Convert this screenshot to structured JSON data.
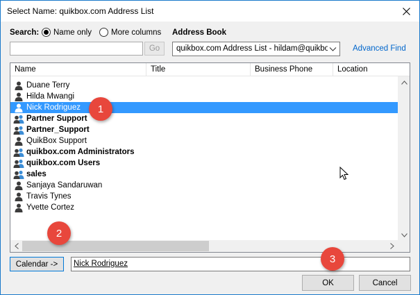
{
  "window": {
    "title": "Select Name: quikbox.com Address List"
  },
  "search": {
    "label": "Search:",
    "options": [
      {
        "label": "Name only",
        "selected": true
      },
      {
        "label": "More columns",
        "selected": false
      }
    ],
    "input_value": "",
    "go_label": "Go"
  },
  "address_book": {
    "label": "Address Book",
    "selected": "quikbox.com Address List - hildam@quikbox.com",
    "advanced_find": "Advanced Find"
  },
  "table": {
    "columns": [
      "Name",
      "Title",
      "Business Phone",
      "Location"
    ],
    "rows": [
      {
        "name": "Duane Terry",
        "type": "user",
        "bold": false,
        "selected": false
      },
      {
        "name": "Hilda Mwangi",
        "type": "user",
        "bold": false,
        "selected": false
      },
      {
        "name": "Nick Rodriguez",
        "type": "user",
        "bold": false,
        "selected": true
      },
      {
        "name": "Partner Support",
        "type": "group",
        "bold": true,
        "selected": false
      },
      {
        "name": "Partner_Support",
        "type": "group",
        "bold": true,
        "selected": false
      },
      {
        "name": "QuikBox Support",
        "type": "user",
        "bold": false,
        "selected": false
      },
      {
        "name": "quikbox.com Administrators",
        "type": "group",
        "bold": true,
        "selected": false
      },
      {
        "name": "quikbox.com Users",
        "type": "group",
        "bold": true,
        "selected": false
      },
      {
        "name": "sales",
        "type": "group",
        "bold": true,
        "selected": false
      },
      {
        "name": "Sanjaya Sandaruwan",
        "type": "user",
        "bold": false,
        "selected": false
      },
      {
        "name": "Travis Tynes",
        "type": "user",
        "bold": false,
        "selected": false
      },
      {
        "name": "Yvette Cortez",
        "type": "user",
        "bold": false,
        "selected": false
      }
    ]
  },
  "calendar": {
    "button_label": "Calendar ->",
    "value": "Nick Rodriguez"
  },
  "buttons": {
    "ok": "OK",
    "cancel": "Cancel"
  },
  "callouts": [
    "1",
    "2",
    "3"
  ],
  "colors": {
    "selection": "#3399ff",
    "callout": "#e8473c",
    "link": "#0066cc"
  }
}
